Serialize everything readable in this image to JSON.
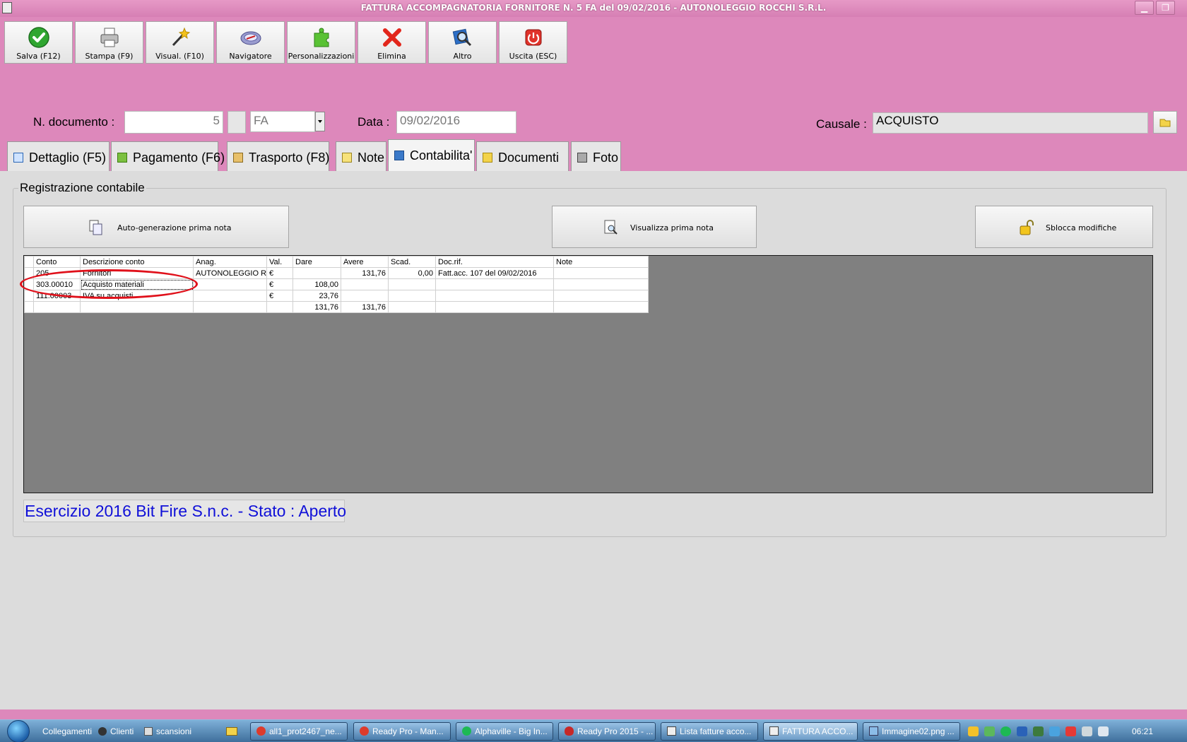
{
  "window": {
    "title": "FATTURA ACCOMPAGNATORIA FORNITORE N. 5 FA del 09/02/2016 - AUTONOLEGGIO ROCCHI S.R.L.",
    "minimize": "▁",
    "restore": "❐"
  },
  "toolbar": {
    "buttons": [
      {
        "label": "Salva (F12)",
        "icon": "checkmark-icon"
      },
      {
        "label": "Stampa (F9)",
        "icon": "printer-icon"
      },
      {
        "label": "Visual. (F10)",
        "icon": "magic-wand-icon"
      },
      {
        "label": "Navigatore",
        "icon": "compass-icon"
      },
      {
        "label": "Personalizzazioni",
        "icon": "puzzle-icon"
      },
      {
        "label": "Elimina",
        "icon": "delete-x-icon"
      },
      {
        "label": "Altro",
        "icon": "magnifier-icon"
      },
      {
        "label": "Uscita (ESC)",
        "icon": "power-icon"
      }
    ]
  },
  "header": {
    "doc_number_label": "N. documento :",
    "doc_number": "5",
    "series": "FA",
    "date_label": "Data :",
    "date": "09/02/2016",
    "causale_label": "Causale :",
    "causale": "ACQUISTO"
  },
  "tabs": [
    {
      "label": "Dettaglio (F5)",
      "icon": "window-icon"
    },
    {
      "label": "Pagamento (F6)",
      "icon": "money-icon"
    },
    {
      "label": "Trasporto (F8)",
      "icon": "truck-icon"
    },
    {
      "label": "Note",
      "icon": "note-icon"
    },
    {
      "label": "Contabilita'",
      "icon": "ledger-icon",
      "active": true
    },
    {
      "label": "Documenti",
      "icon": "documents-icon"
    },
    {
      "label": "Foto",
      "icon": "camera-icon"
    }
  ],
  "registrazione": {
    "title": "Registrazione contabile",
    "btn_auto": "Auto-generazione prima nota",
    "btn_view": "Visualizza prima nota",
    "btn_unlock": "Sblocca modifiche"
  },
  "grid": {
    "columns": [
      "Conto",
      "Descrizione conto",
      "Anag.",
      "Val.",
      "Dare",
      "Avere",
      "Scad.",
      "Doc.rif.",
      "Note"
    ],
    "rows": [
      [
        "205",
        "Fornitori",
        "AUTONOLEGGIO RO",
        "€",
        "",
        "131,76",
        "0,00",
        "Fatt.acc. 107 del 09/02/2016",
        ""
      ],
      [
        "303.00010",
        "Acquisto materiali",
        "",
        "€",
        "108,00",
        "",
        "",
        "",
        ""
      ],
      [
        "111.00003",
        "IVA su acquisti",
        "",
        "€",
        "23,76",
        "",
        "",
        "",
        ""
      ],
      [
        "",
        "",
        "",
        "",
        "131,76",
        "131,76",
        "",
        "",
        ""
      ]
    ]
  },
  "status": "Esercizio 2016 Bit Fire S.n.c. - Stato : Aperto",
  "taskbar": {
    "quicklaunch": [
      "Collegamenti",
      "Clienti",
      "scansioni"
    ],
    "tasks": [
      "all1_prot2467_ne...",
      "Ready Pro - Man...",
      "Alphaville - Big In...",
      "Ready Pro 2015 - ...",
      "Lista fatture acco...",
      "FATTURA ACCO...",
      "Immagine02.png ..."
    ],
    "clock": "06:21"
  },
  "colors": {
    "background": "#dd88bb",
    "status_text": "#1010d8",
    "annotation": "#e0101a"
  }
}
